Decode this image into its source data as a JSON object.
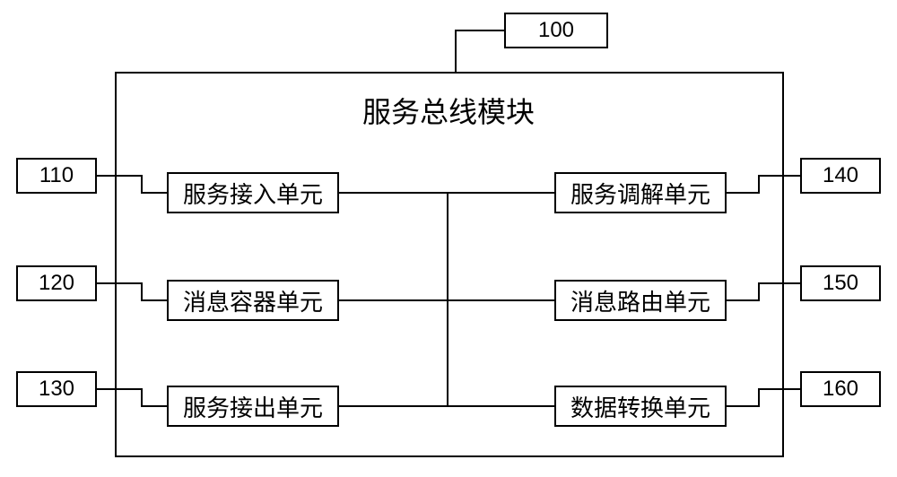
{
  "chart_data": {
    "type": "block-diagram",
    "title": "服务总线模块",
    "main_module": {
      "id": "100",
      "name": "服务总线模块"
    },
    "units": [
      {
        "id": "110",
        "name": "服务接入单元",
        "side": "left",
        "row": 0
      },
      {
        "id": "120",
        "name": "消息容器单元",
        "side": "left",
        "row": 1
      },
      {
        "id": "130",
        "name": "服务接出单元",
        "side": "left",
        "row": 2
      },
      {
        "id": "140",
        "name": "服务调解单元",
        "side": "right",
        "row": 0
      },
      {
        "id": "150",
        "name": "消息路由单元",
        "side": "right",
        "row": 1
      },
      {
        "id": "160",
        "name": "数据转换单元",
        "side": "right",
        "row": 2
      }
    ]
  },
  "title": "服务总线模块",
  "label_100": "100",
  "label_110": "110",
  "label_120": "120",
  "label_130": "130",
  "label_140": "140",
  "label_150": "150",
  "label_160": "160",
  "unit_110": "服务接入单元",
  "unit_120": "消息容器单元",
  "unit_130": "服务接出单元",
  "unit_140": "服务调解单元",
  "unit_150": "消息路由单元",
  "unit_160": "数据转换单元"
}
